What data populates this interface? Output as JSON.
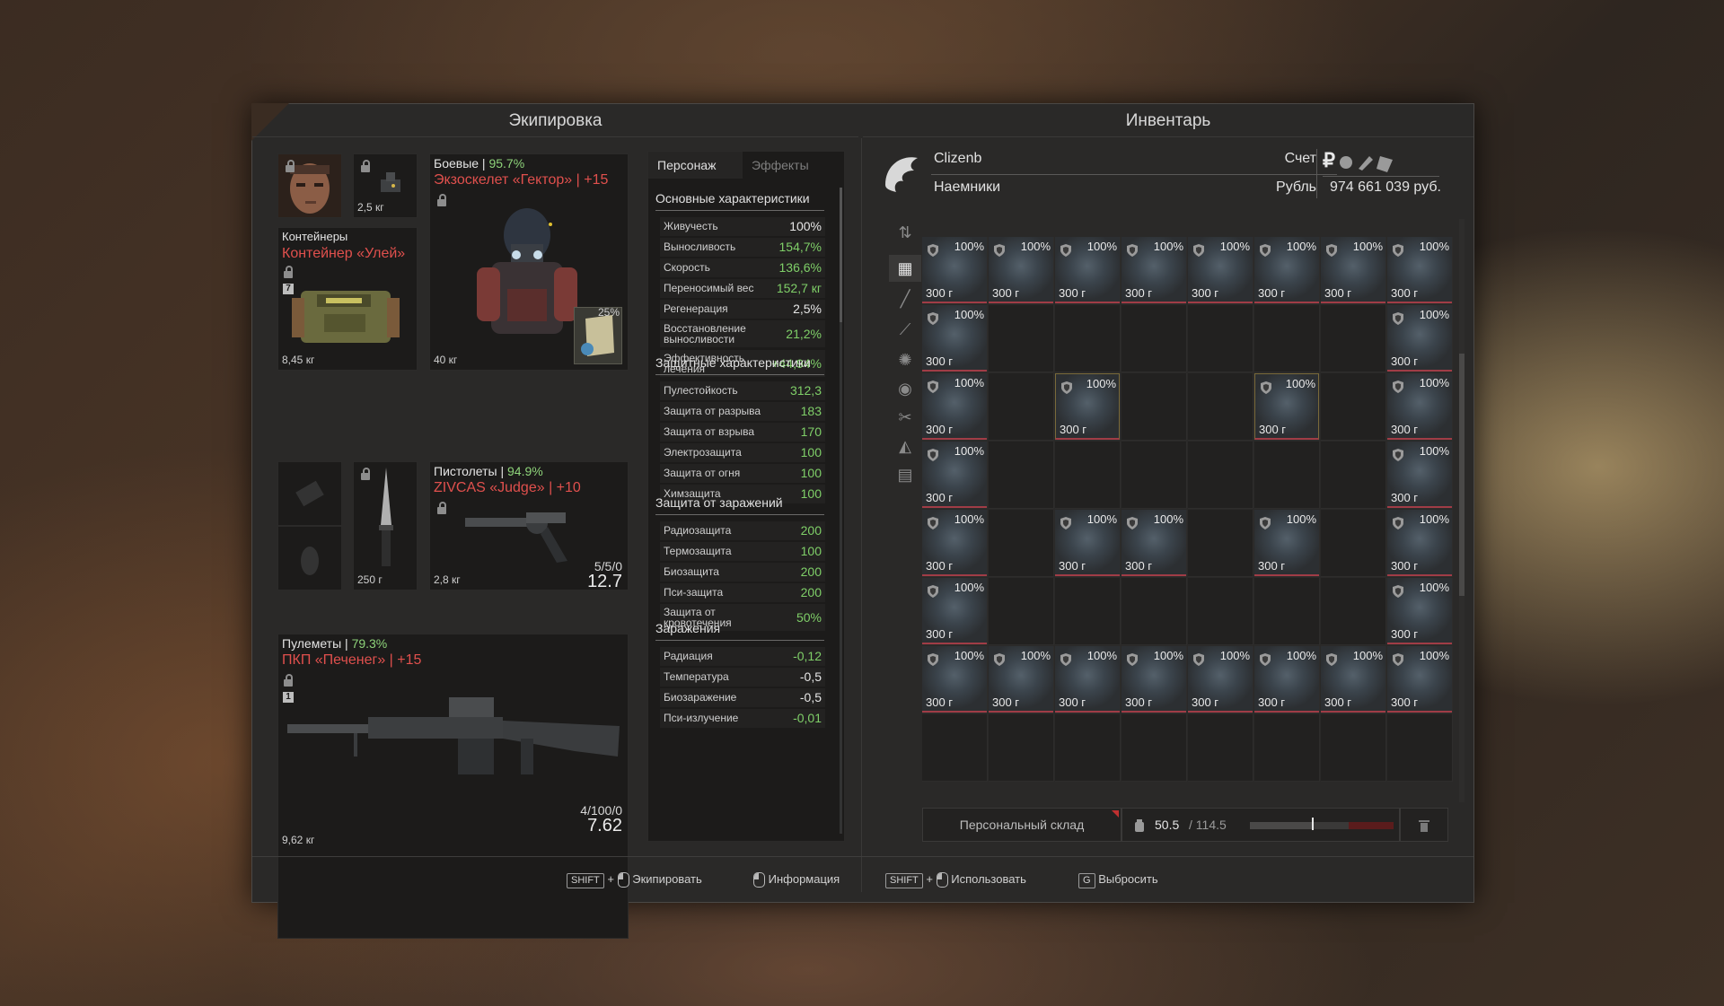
{
  "equipment": {
    "title": "Экипировка",
    "face_slot": {},
    "device_slot": {
      "weight": "2,5 кг"
    },
    "container": {
      "category": "Контейнеры",
      "name": "Контейнер «Улей»",
      "badge": "7",
      "weight": "8,45 кг"
    },
    "armor": {
      "category": "Боевые",
      "sep": " | ",
      "condition": "95.7%",
      "name": "Экзоскелет «Гектор» | +15",
      "weight": "40 кг",
      "plate_pct": "25%"
    },
    "knife": {
      "weight": "250 г"
    },
    "pistol": {
      "category": "Пистолеты",
      "sep": " | ",
      "condition": "94.9%",
      "name": "ZIVCAS «Judge» | +10",
      "weight": "2,8 кг",
      "ammo": "5/5/0",
      "caliber": "12.7"
    },
    "mg": {
      "category": "Пулеметы",
      "sep": " | ",
      "condition": "79.3%",
      "name": "ПКП «Печенег» | +15",
      "badge": "1",
      "weight": "9,62 кг",
      "ammo": "4/100/0",
      "caliber": "7.62"
    }
  },
  "stats": {
    "tabs": [
      "Персонаж",
      "Эффекты"
    ],
    "sections": [
      {
        "title": "Основные характеристики",
        "rows": [
          {
            "label": "Живучесть",
            "value": "100%",
            "color": "#e6e6e6"
          },
          {
            "label": "Выносливость",
            "value": "154,7%",
            "color": "#7fcf68"
          },
          {
            "label": "Скорость",
            "value": "136,6%",
            "color": "#7fcf68"
          },
          {
            "label": "Переносимый вес",
            "value": "152,7 кг",
            "color": "#7fcf68"
          },
          {
            "label": "Регенерация",
            "value": "2,5%",
            "color": "#e6e6e6"
          },
          {
            "label": "Восстановление выносливости",
            "value": "21,2%",
            "color": "#7fcf68"
          },
          {
            "label": "Эффективность лечения",
            "value": "+44,94%",
            "color": "#7fcf68"
          }
        ]
      },
      {
        "title": "Защитные характеристики",
        "rows": [
          {
            "label": "Пулестойкость",
            "value": "312,3",
            "color": "#7fcf68"
          },
          {
            "label": "Защита от разрыва",
            "value": "183",
            "color": "#7fcf68"
          },
          {
            "label": "Защита от взрыва",
            "value": "170",
            "color": "#7fcf68"
          },
          {
            "label": "Электрозащита",
            "value": "100",
            "color": "#7fcf68"
          },
          {
            "label": "Защита от огня",
            "value": "100",
            "color": "#7fcf68"
          },
          {
            "label": "Химзащита",
            "value": "100",
            "color": "#7fcf68"
          }
        ]
      },
      {
        "title": "Защита от заражений",
        "rows": [
          {
            "label": "Радиозащита",
            "value": "200",
            "color": "#7fcf68"
          },
          {
            "label": "Термозащита",
            "value": "100",
            "color": "#7fcf68"
          },
          {
            "label": "Биозащита",
            "value": "200",
            "color": "#7fcf68"
          },
          {
            "label": "Пси-защита",
            "value": "200",
            "color": "#7fcf68"
          },
          {
            "label": "Защита от кровотечения",
            "value": "50%",
            "color": "#7fcf68"
          }
        ]
      },
      {
        "title": "Заражения",
        "rows": [
          {
            "label": "Радиация",
            "value": "-0,12",
            "color": "#7fcf68"
          },
          {
            "label": "Температура",
            "value": "-0,5",
            "color": "#e6e6e6"
          },
          {
            "label": "Биозаражение",
            "value": "-0,5",
            "color": "#e6e6e6"
          },
          {
            "label": "Пси-излучение",
            "value": "-0,01",
            "color": "#7fcf68"
          }
        ]
      }
    ]
  },
  "inventory": {
    "title": "Инвентарь",
    "player": "Clizenb",
    "faction": "Наемники",
    "account_label": "Счет",
    "currency_label": "Рубль",
    "currency_symbol": "₽",
    "balance": "974 661 039 руб.",
    "item": {
      "percent": "100%",
      "weight": "300 г"
    },
    "filled_cells": [
      "0,0",
      "0,1",
      "0,2",
      "0,3",
      "0,4",
      "0,5",
      "0,6",
      "0,7",
      "1,0",
      "1,7",
      "2,0",
      "2,2",
      "2,5",
      "2,7",
      "3,0",
      "3,7",
      "4,0",
      "4,2",
      "4,3",
      "4,5",
      "4,7",
      "5,0",
      "5,7",
      "6,0",
      "6,1",
      "6,2",
      "6,3",
      "6,4",
      "6,5",
      "6,6",
      "6,7"
    ],
    "gold_cells": [
      "2,2",
      "2,5"
    ],
    "storage_button": "Персональный склад",
    "weight_current": "50.5",
    "weight_max": "/ 114.5",
    "weight_fill": 0.44,
    "sidebar_icons": [
      "sort-icon",
      "grid-icon",
      "rifle-icon",
      "knife-icon",
      "armor-icon",
      "device-icon",
      "tools-icon",
      "misc-icon",
      "box-icon"
    ]
  },
  "footer": {
    "equip_key": "SHIFT",
    "plus": "+",
    "equip_label": "Экипировать",
    "info_label": "Информация",
    "use_key": "SHIFT",
    "use_label": "Использовать",
    "drop_key": "G",
    "drop_label": "Выбросить"
  }
}
